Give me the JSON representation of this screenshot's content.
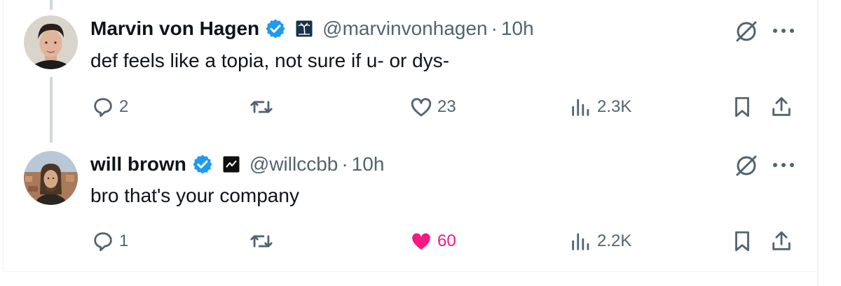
{
  "tweets": [
    {
      "author_name": "Marvin von Hagen",
      "handle": "@marvinvonhagen",
      "separator": "·",
      "time": "10h",
      "text": "def feels like a topia, not sure if u- or dys-",
      "verified": true,
      "affiliation_icon": "palm-tree-badge-icon",
      "stats": {
        "replies": "2",
        "reposts": "",
        "likes": "23",
        "views": "2.3K"
      },
      "liked": false
    },
    {
      "author_name": "will brown",
      "handle": "@willccbb",
      "separator": "·",
      "time": "10h",
      "text": "bro that's your company",
      "verified": true,
      "affiliation_icon": "zigzag-badge-icon",
      "stats": {
        "replies": "1",
        "reposts": "",
        "likes": "60",
        "views": "2.2K"
      },
      "liked": true
    }
  ],
  "colors": {
    "text": "#0f1419",
    "secondary": "#536471",
    "verified": "#1d9bf0",
    "like_active": "#f91880",
    "thread_line": "#cfd9de",
    "divider": "#eff3f4"
  }
}
